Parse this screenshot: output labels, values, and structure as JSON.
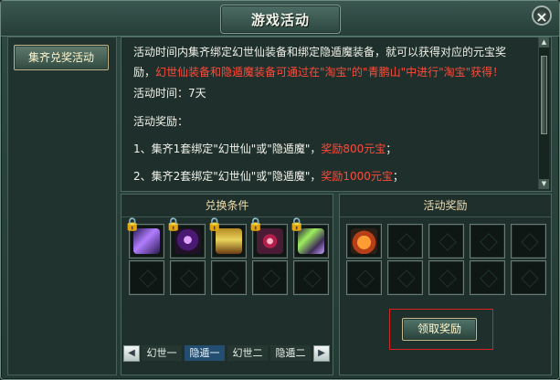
{
  "window": {
    "title": "游戏活动",
    "close_icon": "×"
  },
  "sidebar": {
    "items": [
      {
        "label": "集齐兑奖活动"
      }
    ]
  },
  "description": {
    "intro_a": "活动时间内集齐绑定幻世仙装备和绑定隐遁魔装备，就可以获得对应的元宝奖",
    "intro_b_prefix": "励，",
    "intro_b_red": "幻世仙装备和隐遁魔装备可通过在\"淘宝\"的\"青鹏山\"中进行\"淘宝\"获得！",
    "time_label": "活动时间：7天",
    "reward_label": "活动奖励：",
    "rewards": [
      {
        "prefix": "1、集齐1套绑定\"幻世仙\"或\"隐遁魔\"，",
        "reward": "奖励800元宝",
        "suffix": "；"
      },
      {
        "prefix": "2、集齐2套绑定\"幻世仙\"或\"隐遁魔\"，",
        "reward": "奖励1000元宝",
        "suffix": "；"
      }
    ]
  },
  "exchange_panel": {
    "title": "兑换条件"
  },
  "reward_panel": {
    "title": "活动奖励",
    "claim_button": "领取奖励"
  },
  "tabs": [
    {
      "label": "幻世一"
    },
    {
      "label": "隐遁一"
    },
    {
      "label": "幻世二"
    },
    {
      "label": "隐遁二"
    }
  ],
  "icons": [
    "sword-icon",
    "necklace-icon",
    "armor-icon",
    "ring-icon",
    "glove-icon",
    "bag-icon",
    "lock-icon",
    "arrow-left-icon",
    "arrow-right-icon"
  ],
  "colors": {
    "accent": "#f0ddb1",
    "warning": "#ff4a39",
    "selection": "#234e72"
  }
}
